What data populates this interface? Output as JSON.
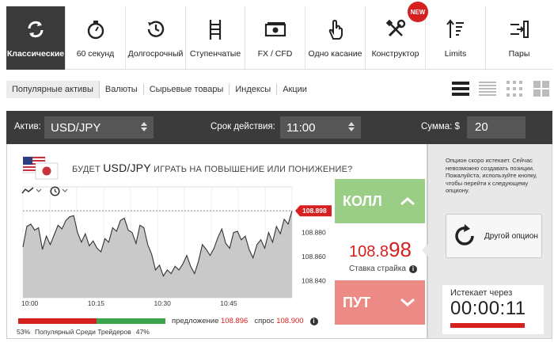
{
  "tabs": [
    {
      "label": "Классические",
      "icon": "refresh-icon",
      "active": true
    },
    {
      "label": "60 секунд",
      "icon": "stopwatch-icon"
    },
    {
      "label": "Долгосрочный",
      "icon": "history-clock-icon"
    },
    {
      "label": "Ступенчатые",
      "icon": "ladder-icon"
    },
    {
      "label": "FX / CFD",
      "icon": "banknote-icon"
    },
    {
      "label": "Одно касание",
      "icon": "touch-hand-icon"
    },
    {
      "label": "Конструктор",
      "icon": "tools-icon"
    },
    {
      "label": "Limits",
      "icon": "limits-icon"
    },
    {
      "label": "Пары",
      "icon": "pairs-icon"
    }
  ],
  "new_badge": "NEW",
  "subnav": [
    "Популярные активы",
    "Валюты",
    "Сырьевые товары",
    "Индексы",
    "Акции"
  ],
  "controls": {
    "asset_label": "Актив:",
    "asset_value": "USD/JPY",
    "expiry_label": "Срок действия:",
    "expiry_value": "11:00",
    "amount_label": "Сумма: $",
    "amount_value": "20"
  },
  "question": {
    "prefix": "БУДЕТ",
    "pair": "USD/JPY",
    "suffix": "ИГРАТЬ НА ПОВЫШЕНИЕ ИЛИ ПОНИЖЕНИЕ?"
  },
  "chart_data": {
    "type": "area",
    "x_ticks": [
      "10:00",
      "10:15",
      "10:30",
      "10:45"
    ],
    "y_ticks": [
      "108.900",
      "108.880",
      "108.860",
      "108.840"
    ],
    "ylim": [
      108.826,
      108.906
    ],
    "current_price_label": "108.898",
    "series": [
      {
        "values": [
          108.868,
          108.885,
          108.887,
          108.882,
          108.884,
          108.866,
          108.877,
          108.87,
          108.878,
          108.886,
          108.883,
          108.89,
          108.893,
          108.894,
          108.88,
          108.872,
          108.879,
          108.869,
          108.873,
          108.867,
          108.864,
          108.875,
          108.872,
          108.884,
          108.881,
          108.89,
          108.892,
          108.882,
          108.88,
          108.871,
          108.886,
          108.884,
          108.87,
          108.862,
          108.849,
          108.853,
          108.844,
          108.849,
          108.846,
          108.852,
          108.849,
          108.854,
          108.861,
          108.852,
          108.846,
          108.856,
          108.87,
          108.866,
          108.861,
          108.867,
          108.876,
          108.883,
          108.871,
          108.867,
          108.88,
          108.881,
          108.874,
          108.877,
          108.866,
          108.859,
          108.87,
          108.874,
          108.867,
          108.88,
          108.872,
          108.885,
          108.879,
          108.891,
          108.887,
          108.898
        ]
      }
    ]
  },
  "call_label": "КОЛЛ",
  "put_label": "ПУТ",
  "strike": {
    "main": "108.8",
    "big": "98",
    "label": "Ставка страйка"
  },
  "quotes": {
    "bid_label": "предложение",
    "bid": "108.896",
    "ask_label": "спрос",
    "ask": "108.900"
  },
  "sentiment": {
    "left_pct": "53%",
    "label": "Популярный Среди Трейдеров",
    "right_pct": "47%",
    "left_value": 53,
    "right_value": 47,
    "left_color": "#d61f1f",
    "right_color": "#3ba34a"
  },
  "right_panel": {
    "message": "Опцион скоро истекает. Сейчас невозможно создавать позиции. Пожалуйста, используйте кнопку, чтобы перейти к следующему опциону.",
    "another_label": "Другой опцион",
    "expires_label": "Истекает через",
    "timer": "00:00:11"
  },
  "colors": {
    "accent_red": "#d61f1f",
    "call_green": "#9acd86",
    "put_red": "#ec8b86",
    "bar_dark": "#3b3b3b"
  }
}
